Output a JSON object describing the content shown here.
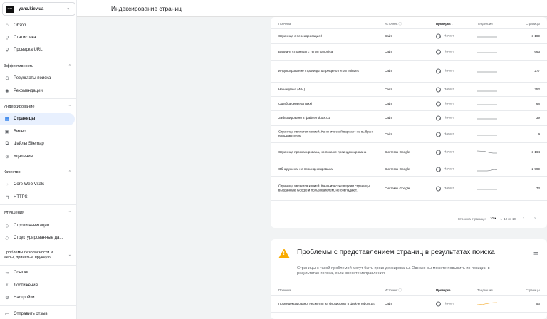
{
  "property": {
    "logo_text": "YANA",
    "name": "yana.kiev.ua"
  },
  "topbar": {
    "title": "Индексирование страниц"
  },
  "sidebar": {
    "top_items": [
      {
        "icon": "home-icon",
        "glyph": "⌂",
        "label": "Обзор"
      },
      {
        "icon": "trend-icon",
        "glyph": "⚲",
        "label": "Статистика"
      },
      {
        "icon": "search-icon",
        "glyph": "⚲",
        "label": "Проверка URL"
      }
    ],
    "sections": [
      {
        "key": "performance",
        "title": "Эффективность",
        "items": [
          {
            "icon": "google-icon",
            "glyph": "G",
            "label": "Результаты поиска"
          },
          {
            "icon": "discover-icon",
            "glyph": "✺",
            "label": "Рекомендации"
          }
        ]
      },
      {
        "key": "indexing",
        "title": "Индексирование",
        "items": [
          {
            "icon": "pages-icon",
            "glyph": "▤",
            "label": "Страницы"
          },
          {
            "icon": "video-icon",
            "glyph": "▣",
            "label": "Видео"
          },
          {
            "icon": "sitemap-icon",
            "glyph": "⧉",
            "label": "Файлы Sitemap"
          },
          {
            "icon": "removals-icon",
            "glyph": "⊘",
            "label": "Удаления"
          }
        ]
      },
      {
        "key": "experience",
        "title": "Качество",
        "items": [
          {
            "icon": "gauge-icon",
            "glyph": "◔",
            "label": "Core Web Vitals"
          },
          {
            "icon": "lock-icon",
            "glyph": "⊓",
            "label": "HTTPS"
          }
        ]
      },
      {
        "key": "enhancements",
        "title": "Улучшения",
        "items": [
          {
            "icon": "breadcrumbs-icon",
            "glyph": "◇",
            "label": "Строки навигации"
          },
          {
            "icon": "structured-data-icon",
            "glyph": "◇",
            "label": "Структурированные да..."
          }
        ]
      },
      {
        "key": "security",
        "title": "Проблемы безопасности и меры, принятые вручную",
        "items": [
          {
            "icon": "links-icon",
            "glyph": "∞",
            "label": "Ссылки"
          },
          {
            "icon": "achievements-icon",
            "glyph": "♆",
            "label": "Достижения"
          },
          {
            "icon": "settings-icon",
            "glyph": "⚙",
            "label": "Настройки"
          }
        ]
      }
    ],
    "feedback": {
      "icon": "feedback-icon",
      "glyph": "▭",
      "label": "Отправить отзыв"
    }
  },
  "table": {
    "headers": {
      "reason": "Причина",
      "source": "Источник",
      "check": "Проверка",
      "trend": "Тенденция",
      "pages": "Страницы"
    },
    "rows": [
      {
        "reason": "Страница с переадресацией",
        "source": "Сайт",
        "check": "Начато",
        "trend": "flat",
        "pages": "3 189"
      },
      {
        "reason": "Вариант страницы с тегом canonical",
        "source": "Сайт",
        "check": "Начато",
        "trend": "flat",
        "pages": "663"
      },
      {
        "reason": "Индексирование страницы запрещено тегом noindex",
        "source": "Сайт",
        "check": "Начато",
        "trend": "flat",
        "pages": "277"
      },
      {
        "reason": "Не найдено (404)",
        "source": "Сайт",
        "check": "Начато",
        "trend": "flat-low",
        "pages": "252"
      },
      {
        "reason": "Ошибка сервера (5xx)",
        "source": "Сайт",
        "check": "Начато",
        "trend": "flat",
        "pages": "68"
      },
      {
        "reason": "Заблокировано в файле robots.txt",
        "source": "Сайт",
        "check": "Начато",
        "trend": "flat",
        "pages": "39"
      },
      {
        "reason": "Страница является копией. Канонический вариант не выбран пользователем.",
        "source": "Сайт",
        "check": "Начато",
        "trend": "flat",
        "pages": "9"
      },
      {
        "reason": "Страница просканирована, но пока не проиндексирована",
        "source": "Системы Google",
        "check": "Начато",
        "trend": "down",
        "pages": "3 164"
      },
      {
        "reason": "Обнаружена, не проиндексирована",
        "source": "Системы Google",
        "check": "Начато",
        "trend": "up",
        "pages": "2 999"
      },
      {
        "reason": "Страница является копией. Канонические версии страницы, выбранные Google и пользователем, не совпадают.",
        "source": "Системы Google",
        "check": "Начато",
        "trend": "flat",
        "pages": "73"
      }
    ],
    "pager": {
      "rows_label": "Строк на странице:",
      "rows_value": "10",
      "range": "1–10 из 10"
    }
  },
  "warning_card": {
    "title": "Проблемы с представлением страниц в результатах поиска",
    "subtitle": "Страницы с такой проблемой могут быть проиндексированы. Однако вы можете повысить их позиции в результатах поиска, если внесете исправления.",
    "headers": {
      "reason": "Причина",
      "source": "Источник",
      "check": "Проверка",
      "trend": "Тенденция",
      "pages": "Страницы"
    },
    "rows": [
      {
        "reason": "Проиндексировано, несмотря на блокировку в файле robots.txt",
        "source": "Сайт",
        "check": "Начато",
        "trend": "orange",
        "pages": "53"
      }
    ]
  },
  "colors": {
    "accent": "#1a73e8",
    "warning": "#f9ab00",
    "trend_line": "#5f6368",
    "trend_orange": "#f29900"
  }
}
